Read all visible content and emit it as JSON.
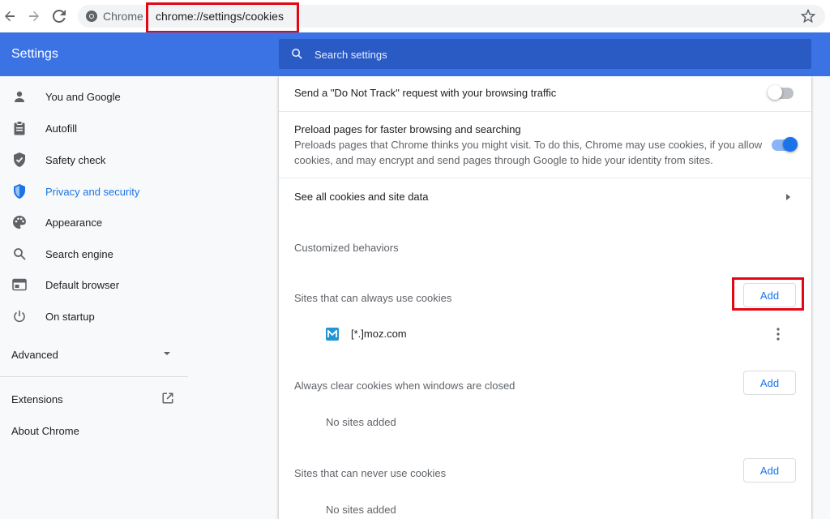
{
  "browser": {
    "omnibox_label": "Chrome",
    "url": "chrome://settings/cookies"
  },
  "header": {
    "title": "Settings",
    "search_placeholder": "Search settings"
  },
  "sidebar": {
    "items": [
      {
        "label": "You and Google",
        "icon": "person-icon"
      },
      {
        "label": "Autofill",
        "icon": "clipboard-icon"
      },
      {
        "label": "Safety check",
        "icon": "shield-check-icon"
      },
      {
        "label": "Privacy and security",
        "icon": "shield-icon",
        "active": true
      },
      {
        "label": "Appearance",
        "icon": "palette-icon"
      },
      {
        "label": "Search engine",
        "icon": "search-icon"
      },
      {
        "label": "Default browser",
        "icon": "browser-window-icon"
      },
      {
        "label": "On startup",
        "icon": "power-icon"
      }
    ],
    "advanced_label": "Advanced",
    "extensions_label": "Extensions",
    "about_label": "About Chrome"
  },
  "main": {
    "do_not_track": {
      "label": "Send a \"Do Not Track\" request with your browsing traffic",
      "enabled": false
    },
    "preload": {
      "label": "Preload pages for faster browsing and searching",
      "description_line1": "Preloads pages that Chrome thinks you might visit. To do this, Chrome may use cookies, if you allow",
      "description_line2": "cookies, and may encrypt and send pages through Google to hide your identity from sites.",
      "enabled": true
    },
    "see_all_cookies": "See all cookies and site data",
    "customized_behaviors": "Customized behaviors",
    "sections": {
      "always_allow": {
        "label": "Sites that can always use cookies",
        "button": "Add",
        "site": "[*.]moz.com"
      },
      "clear_on_exit": {
        "label": "Always clear cookies when windows are closed",
        "button": "Add",
        "empty": "No sites added"
      },
      "never_allow": {
        "label": "Sites that can never use cookies",
        "button": "Add",
        "empty": "No sites added"
      }
    }
  },
  "colors": {
    "header_blue": "#3b73e4",
    "accent": "#1a73e8",
    "highlight_red": "#e30613"
  }
}
